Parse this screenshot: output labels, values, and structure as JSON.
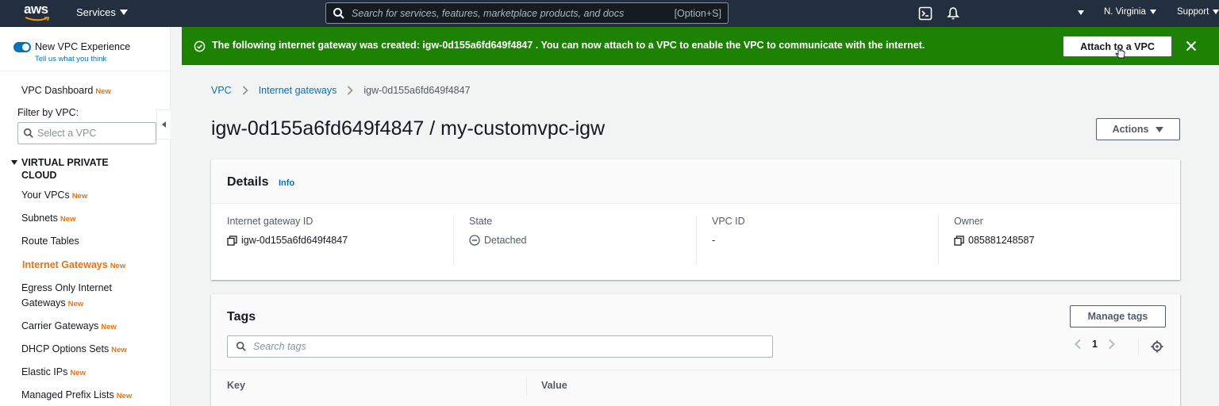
{
  "topnav": {
    "logo_text": "aws",
    "services_label": "Services",
    "search_placeholder": "Search for services, features, marketplace products, and docs",
    "search_shortcut": "[Option+S]",
    "region_label": "N. Virginia",
    "support_label": "Support"
  },
  "sidebar": {
    "toggle_label": "New VPC Experience",
    "toggle_sublabel": "Tell us what you think",
    "dashboard": {
      "label": "VPC Dashboard",
      "badge": "New"
    },
    "filter_label": "Filter by VPC:",
    "filter_placeholder": "Select a VPC",
    "section_title": "VIRTUAL PRIVATE CLOUD",
    "items": [
      {
        "label": "Your VPCs",
        "badge": "New"
      },
      {
        "label": "Subnets",
        "badge": "New"
      },
      {
        "label": "Route Tables",
        "badge": ""
      },
      {
        "label": "Internet Gateways",
        "badge": "New"
      },
      {
        "label": "Egress Only Internet",
        "label2": "Gateways",
        "badge": "New"
      },
      {
        "label": "Carrier Gateways",
        "badge": "New"
      },
      {
        "label": "DHCP Options Sets",
        "badge": "New"
      },
      {
        "label": "Elastic IPs",
        "badge": "New"
      },
      {
        "label": "Managed Prefix Lists",
        "badge": "New"
      }
    ]
  },
  "flash": {
    "message": "The following internet gateway was created: igw-0d155a6fd649f4847 . You can now attach to a VPC to enable the VPC to communicate with the internet.",
    "action_label": "Attach to a VPC",
    "color": "#1d8102"
  },
  "breadcrumb": {
    "items": [
      "VPC",
      "Internet gateways",
      "igw-0d155a6fd649f4847"
    ]
  },
  "page": {
    "title": "igw-0d155a6fd649f4847 / my-customvpc-igw",
    "actions_label": "Actions"
  },
  "details": {
    "title": "Details",
    "info_label": "Info",
    "fields": [
      {
        "label": "Internet gateway ID",
        "value": "igw-0d155a6fd649f4847"
      },
      {
        "label": "State",
        "value": "Detached"
      },
      {
        "label": "VPC ID",
        "value": "-"
      },
      {
        "label": "Owner",
        "value": "085881248587"
      }
    ]
  },
  "tags": {
    "title": "Tags",
    "manage_label": "Manage tags",
    "search_placeholder": "Search tags",
    "page_number": "1",
    "columns": [
      "Key",
      "Value"
    ]
  }
}
